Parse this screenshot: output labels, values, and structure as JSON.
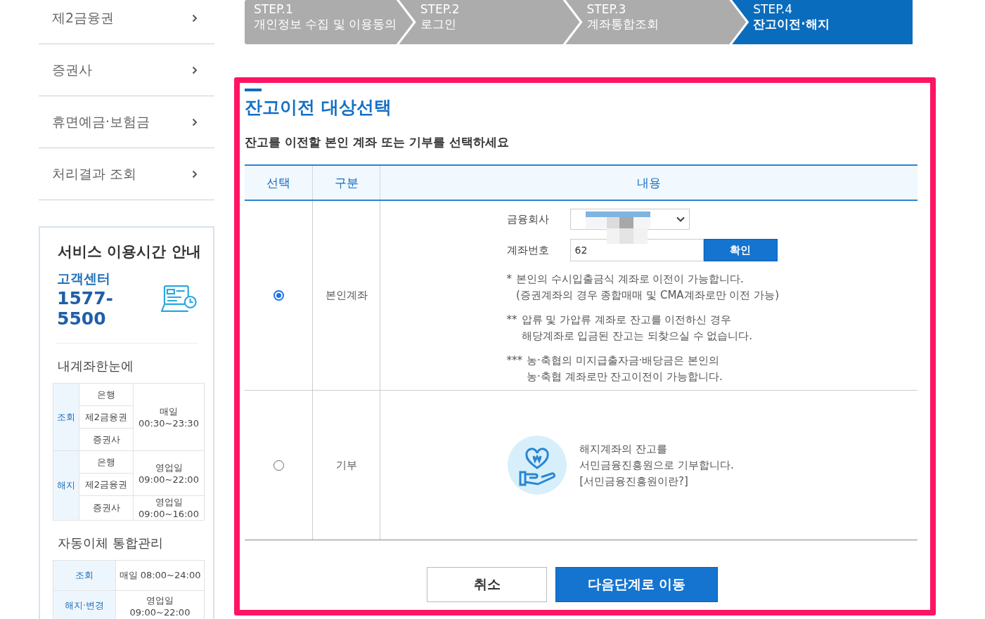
{
  "sidebar": {
    "menu": [
      {
        "label": "제2금융권",
        "selected": false
      },
      {
        "label": "증권사",
        "selected": false
      },
      {
        "label": "휴면예금·보험금",
        "selected": false
      },
      {
        "label": "처리결과 조회",
        "selected": false
      }
    ],
    "service_hours": {
      "title": "서비스 이용시간 안내",
      "center_label": "고객센터",
      "phone": "1577-5500",
      "sections": [
        {
          "title": "내계좌한눈에",
          "kind": "grouped",
          "groups": [
            {
              "label": "조회",
              "slots": [
                {
                  "time": [
                    "매일",
                    "00:30~23:30"
                  ],
                  "names": [
                    "은행",
                    "제2금융권",
                    "증권사"
                  ]
                }
              ]
            },
            {
              "label": "해지",
              "slots": [
                {
                  "time": [
                    "영업일",
                    "09:00~22:00"
                  ],
                  "names": [
                    "은행",
                    "제2금융권"
                  ]
                },
                {
                  "time": [
                    "영업일",
                    "09:00~16:00"
                  ],
                  "names": [
                    "증권사"
                  ]
                }
              ]
            }
          ]
        },
        {
          "title": "자동이체 통합관리",
          "kind": "simple",
          "rows": [
            {
              "label": "조회",
              "value": "매일 08:00~24:00"
            },
            {
              "label": "해지·변경",
              "value": "영업일 09:00~22:00"
            }
          ]
        }
      ]
    }
  },
  "steps": [
    {
      "step": "STEP.1",
      "label": "개인정보 수집 및 이용동의",
      "selected": false
    },
    {
      "step": "STEP.2",
      "label": "로그인",
      "selected": false
    },
    {
      "step": "STEP.3",
      "label": "계좌통합조회",
      "selected": false
    },
    {
      "step": "STEP.4",
      "label": "잔고이전·해지",
      "selected": true
    }
  ],
  "panel": {
    "title": "잔고이전 대상선택",
    "subtitle": "잔고를 이전할 본인 계좌 또는 기부를 선택하세요",
    "columns": [
      "선택",
      "구분",
      "내용"
    ],
    "rows": [
      {
        "kind": "account",
        "selected": true,
        "category": "본인계좌",
        "company_label": "금융회사",
        "account_label": "계좌번호",
        "account_value": "62",
        "confirm": "확인",
        "notes": [
          {
            "mark": "*",
            "lines": [
              "본인의 수시입출금식 계좌로 이전이 가능합니다.",
              "(증권계좌의 경우 종합매매 및 CMA계좌로만 이전 가능)"
            ]
          },
          {
            "mark": "**",
            "lines": [
              "압류 및 가압류 계좌로 잔고를 이전하신 경우",
              "해당계좌로 입금된 잔고는 되찾으실 수 없습니다."
            ]
          },
          {
            "mark": "***",
            "lines": [
              "농·축협의 미지급출자금·배당금은 본인의",
              "농·축협 계좌로만 잔고이전이 가능합니다."
            ]
          }
        ]
      },
      {
        "kind": "donation",
        "selected": false,
        "category": "기부",
        "lines": [
          "해지계좌의 잔고를",
          "서민금융진흥원으로 기부합니다."
        ],
        "link": "[서민금융진흥원이란?]"
      }
    ],
    "buttons": [
      {
        "label": "취소",
        "kind": "secondary"
      },
      {
        "label": "다음단계로 이동",
        "kind": "primary"
      }
    ]
  }
}
